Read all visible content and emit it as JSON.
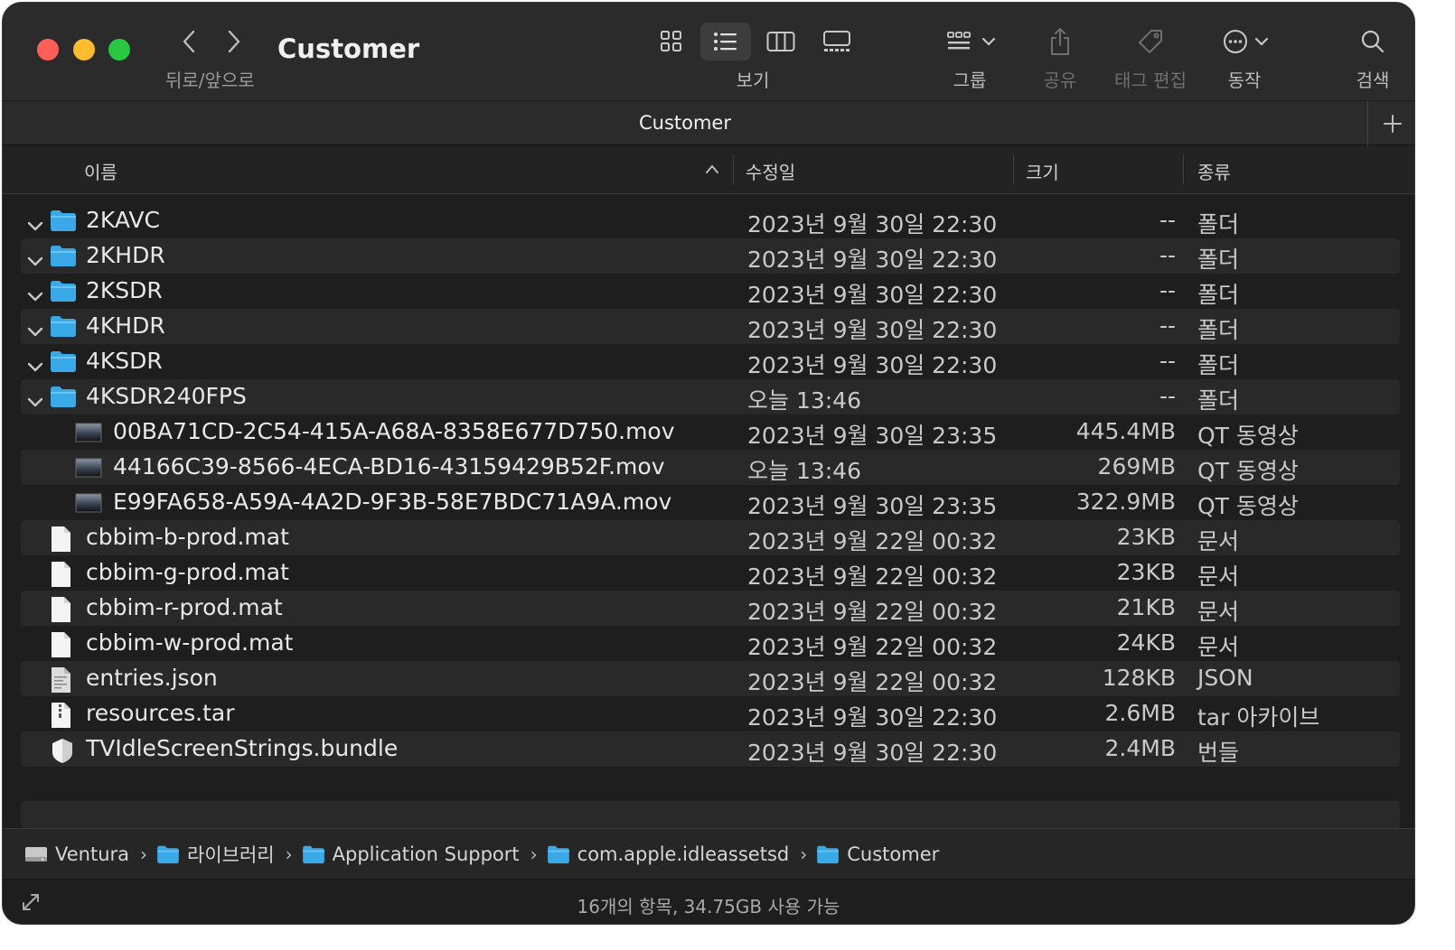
{
  "window": {
    "title": "Customer"
  },
  "toolbar": {
    "nav_label": "뒤로/앞으로",
    "view_label": "보기",
    "group_label": "그룹",
    "share_label": "공유",
    "tags_label": "태그 편집",
    "action_label": "동작",
    "search_label": "검색"
  },
  "tab": {
    "title": "Customer"
  },
  "columns": {
    "name": "이름",
    "date": "수정일",
    "size": "크기",
    "kind": "종류"
  },
  "files": [
    {
      "name": "2KAVC",
      "date": "2023년 9월 30일 22:30",
      "size": "--",
      "kind": "폴더",
      "icon": "folder-icon",
      "disclosure": true
    },
    {
      "name": "2KHDR",
      "date": "2023년 9월 30일 22:30",
      "size": "--",
      "kind": "폴더",
      "icon": "folder-icon",
      "disclosure": true
    },
    {
      "name": "2KSDR",
      "date": "2023년 9월 30일 22:30",
      "size": "--",
      "kind": "폴더",
      "icon": "folder-icon",
      "disclosure": true
    },
    {
      "name": "4KHDR",
      "date": "2023년 9월 30일 22:30",
      "size": "--",
      "kind": "폴더",
      "icon": "folder-icon",
      "disclosure": true
    },
    {
      "name": "4KSDR",
      "date": "2023년 9월 30일 22:30",
      "size": "--",
      "kind": "폴더",
      "icon": "folder-icon",
      "disclosure": true
    },
    {
      "name": "4KSDR240FPS",
      "date": "오늘 13:46",
      "size": "--",
      "kind": "폴더",
      "icon": "folder-icon",
      "disclosure": true
    },
    {
      "name": "00BA71CD-2C54-415A-A68A-8358E677D750.mov",
      "date": "2023년 9월 30일 23:35",
      "size": "445.4MB",
      "kind": "QT 동영상",
      "icon": "video-thumbnail-icon",
      "indent": true
    },
    {
      "name": "44166C39-8566-4ECA-BD16-43159429B52F.mov",
      "date": "오늘 13:46",
      "size": "269MB",
      "kind": "QT 동영상",
      "icon": "video-thumbnail-icon",
      "indent": true
    },
    {
      "name": "E99FA658-A59A-4A2D-9F3B-58E7BDC71A9A.mov",
      "date": "2023년 9월 30일 23:35",
      "size": "322.9MB",
      "kind": "QT 동영상",
      "icon": "video-thumbnail-icon",
      "indent": true
    },
    {
      "name": "cbbim-b-prod.mat",
      "date": "2023년 9월 22일 00:32",
      "size": "23KB",
      "kind": "문서",
      "icon": "document-icon"
    },
    {
      "name": "cbbim-g-prod.mat",
      "date": "2023년 9월 22일 00:32",
      "size": "23KB",
      "kind": "문서",
      "icon": "document-icon"
    },
    {
      "name": "cbbim-r-prod.mat",
      "date": "2023년 9월 22일 00:32",
      "size": "21KB",
      "kind": "문서",
      "icon": "document-icon"
    },
    {
      "name": "cbbim-w-prod.mat",
      "date": "2023년 9월 22일 00:32",
      "size": "24KB",
      "kind": "문서",
      "icon": "document-icon"
    },
    {
      "name": "entries.json",
      "date": "2023년 9월 22일 00:32",
      "size": "128KB",
      "kind": "JSON",
      "icon": "json-file-icon"
    },
    {
      "name": "resources.tar",
      "date": "2023년 9월 30일 22:30",
      "size": "2.6MB",
      "kind": "tar 아카이브",
      "icon": "archive-icon"
    },
    {
      "name": "TVIdleScreenStrings.bundle",
      "date": "2023년 9월 30일 22:30",
      "size": "2.4MB",
      "kind": "번들",
      "icon": "bundle-icon"
    }
  ],
  "path": [
    {
      "label": "Ventura",
      "icon": "disk-icon"
    },
    {
      "label": "라이브러리",
      "icon": "folder-icon"
    },
    {
      "label": "Application Support",
      "icon": "folder-icon"
    },
    {
      "label": "com.apple.idleassetsd",
      "icon": "folder-icon"
    },
    {
      "label": "Customer",
      "icon": "folder-icon"
    }
  ],
  "status": {
    "text": "16개의 항목, 34.75GB 사용 가능"
  },
  "colors": {
    "folder": "#3aa9e8",
    "close": "#ff5f57",
    "minimize": "#febc2e",
    "maximize": "#28c840"
  }
}
